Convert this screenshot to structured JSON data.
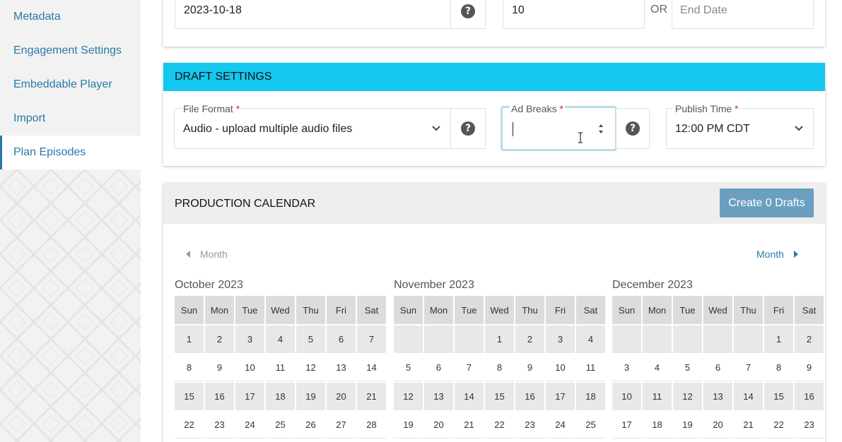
{
  "sidebar": {
    "items": [
      {
        "label": "Metadata",
        "active": false
      },
      {
        "label": "Engagement Settings",
        "active": false
      },
      {
        "label": "Embeddable Player",
        "active": false
      },
      {
        "label": "Import",
        "active": false
      },
      {
        "label": "Plan Episodes",
        "active": true
      }
    ]
  },
  "top_fields": {
    "start_date_value": "2023-10-18",
    "count_value": "10",
    "or_text": "OR",
    "end_date_placeholder": "End Date"
  },
  "draft_settings": {
    "title": "DRAFT SETTINGS",
    "file_format": {
      "label": "File Format",
      "required_mark": "*",
      "value": "Audio - upload multiple audio files"
    },
    "ad_breaks": {
      "label": "Ad Breaks",
      "required_mark": "*",
      "value": ""
    },
    "publish_time": {
      "label": "Publish Time",
      "required_mark": "*",
      "value": "12:00 PM CDT"
    }
  },
  "calendar": {
    "title": "PRODUCTION CALENDAR",
    "create_button": "Create 0 Drafts",
    "prev_label": "Month",
    "next_label": "Month",
    "weekdays": [
      "Sun",
      "Mon",
      "Tue",
      "Wed",
      "Thu",
      "Fri",
      "Sat"
    ],
    "months": [
      {
        "name": "October 2023",
        "weeks": [
          [
            "1",
            "2",
            "3",
            "4",
            "5",
            "6",
            "7"
          ],
          [
            "8",
            "9",
            "10",
            "11",
            "12",
            "13",
            "14"
          ],
          [
            "15",
            "16",
            "17",
            "18",
            "19",
            "20",
            "21"
          ],
          [
            "22",
            "23",
            "24",
            "25",
            "26",
            "27",
            "28"
          ]
        ]
      },
      {
        "name": "November 2023",
        "weeks": [
          [
            "",
            "",
            "",
            "1",
            "2",
            "3",
            "4"
          ],
          [
            "5",
            "6",
            "7",
            "8",
            "9",
            "10",
            "11"
          ],
          [
            "12",
            "13",
            "14",
            "15",
            "16",
            "17",
            "18"
          ],
          [
            "19",
            "20",
            "21",
            "22",
            "23",
            "24",
            "25"
          ]
        ]
      },
      {
        "name": "December 2023",
        "weeks": [
          [
            "",
            "",
            "",
            "",
            "",
            "1",
            "2"
          ],
          [
            "3",
            "4",
            "5",
            "6",
            "7",
            "8",
            "9"
          ],
          [
            "10",
            "11",
            "12",
            "13",
            "14",
            "15",
            "16"
          ],
          [
            "17",
            "18",
            "19",
            "20",
            "21",
            "22",
            "23"
          ]
        ]
      }
    ]
  },
  "colors": {
    "accent_cyan": "#14c8ef",
    "link_blue": "#2a79a8",
    "button_blue": "#6b9fc0",
    "required_red": "#d9243f"
  },
  "icons": [
    "help-icon",
    "chevron-down-icon",
    "caret-left-icon",
    "caret-right-icon",
    "spinner-up-icon",
    "spinner-down-icon",
    "text-cursor-icon"
  ]
}
